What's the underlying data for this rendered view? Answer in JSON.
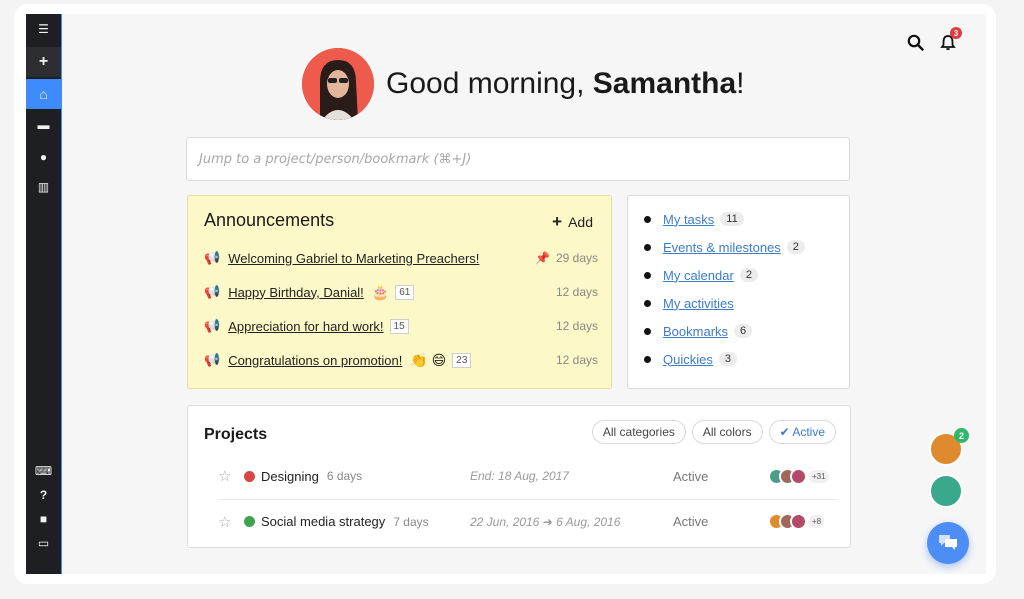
{
  "sidebar": {
    "top_items": [
      {
        "icon": "menu-icon",
        "glyph": "☰"
      },
      {
        "icon": "plus-icon",
        "glyph": "+"
      },
      {
        "icon": "home-icon",
        "glyph": "⌂"
      },
      {
        "icon": "folder-icon",
        "glyph": "▬"
      },
      {
        "icon": "globe-icon",
        "glyph": "●"
      },
      {
        "icon": "chart-icon",
        "glyph": "▥"
      }
    ],
    "bottom_items": [
      {
        "icon": "keyboard-icon",
        "glyph": "⌨"
      },
      {
        "icon": "help-icon",
        "glyph": "?"
      },
      {
        "icon": "chat-icon",
        "glyph": "■"
      },
      {
        "icon": "monitor-icon",
        "glyph": "▭"
      }
    ],
    "accent": "#3d8bfd"
  },
  "header": {
    "notification_count": "3"
  },
  "greeting": {
    "prefix": "Good morning, ",
    "name": "Samantha",
    "suffix": "!"
  },
  "search": {
    "placeholder": "Jump to a project/person/bookmark (⌘+J)"
  },
  "announcements": {
    "title": "Announcements",
    "add_label": "Add",
    "items": [
      {
        "text": "Welcoming Gabriel to Marketing Preachers!",
        "emoji": "",
        "count": "",
        "days": "29 days",
        "pinned": true
      },
      {
        "text": "Happy Birthday, Danial!",
        "emoji": "🎂",
        "count": "61",
        "days": "12 days",
        "pinned": false
      },
      {
        "text": "Appreciation for hard work!",
        "emoji": "",
        "count": "15",
        "days": "12 days",
        "pinned": false
      },
      {
        "text": "Congratulations on promotion!",
        "emoji": "👏 😄",
        "count": "23",
        "days": "12 days",
        "pinned": false
      }
    ]
  },
  "quick_links": [
    {
      "label": "My tasks",
      "count": "11"
    },
    {
      "label": "Events & milestones",
      "count": "2"
    },
    {
      "label": "My calendar",
      "count": "2"
    },
    {
      "label": "My activities",
      "count": ""
    },
    {
      "label": "Bookmarks",
      "count": "6"
    },
    {
      "label": "Quickies",
      "count": "3"
    }
  ],
  "projects": {
    "title": "Projects",
    "filters": [
      "All categories",
      "All colors",
      "Active"
    ],
    "active_filter_check": "✔",
    "rows": [
      {
        "name": "Designing",
        "days": "6 days",
        "date": "End: 18 Aug, 2017",
        "status": "Active",
        "more": "+31",
        "color": "#d94444"
      },
      {
        "name": "Social media strategy",
        "days": "7 days",
        "date": "22 Jun, 2016 ➜ 6 Aug, 2016",
        "status": "Active",
        "more": "+8",
        "color": "#3fa34d"
      }
    ]
  },
  "online_users": {
    "badge": "2"
  }
}
